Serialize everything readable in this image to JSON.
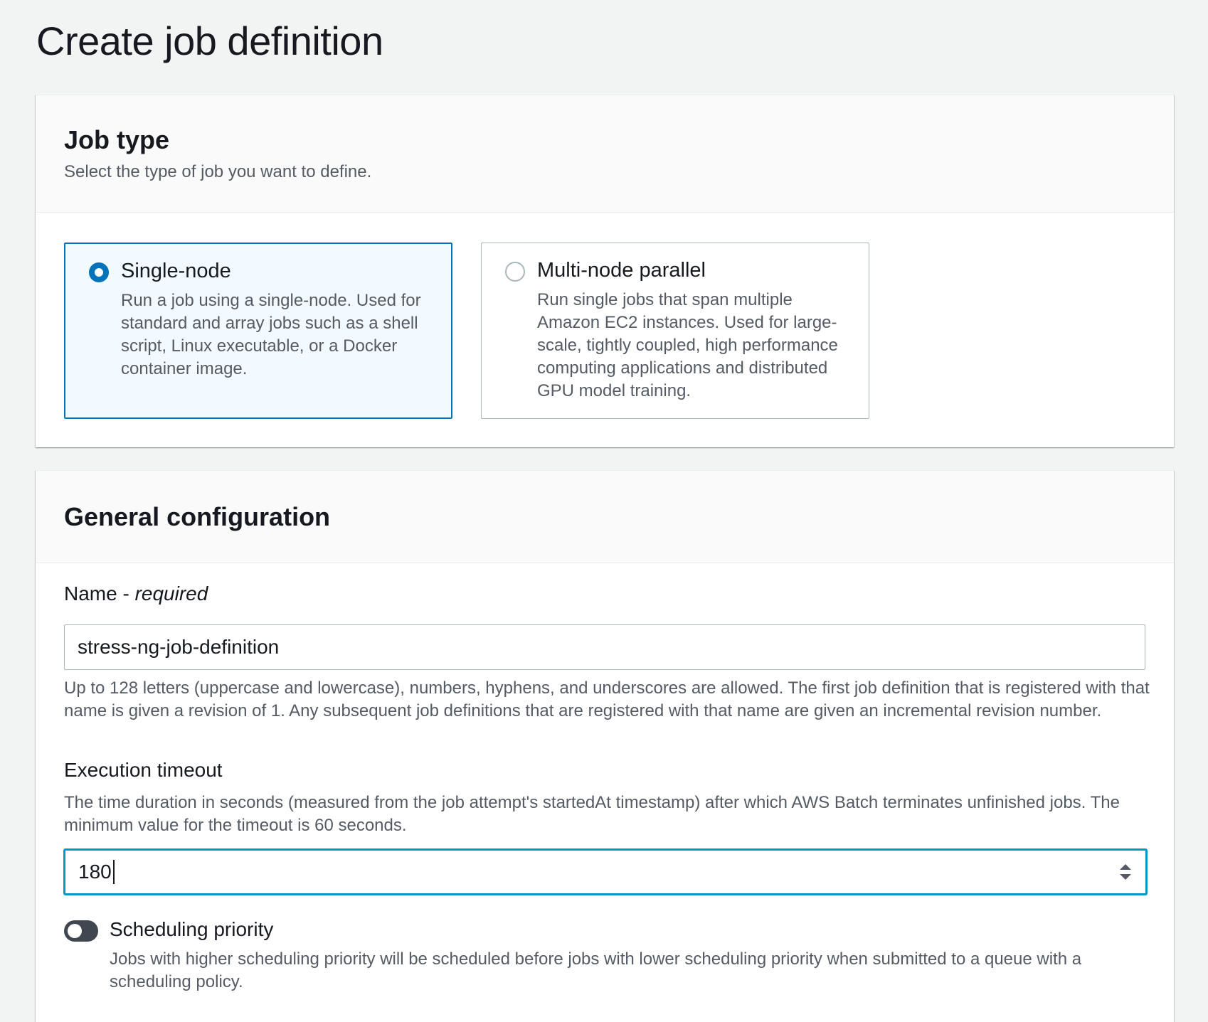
{
  "page": {
    "title": "Create job definition"
  },
  "job_type": {
    "heading": "Job type",
    "description": "Select the type of job you want to define.",
    "options": [
      {
        "title": "Single-node",
        "description": "Run a job using a single-node. Used for standard and array jobs such as a shell script, Linux executable, or a Docker container image.",
        "selected": true
      },
      {
        "title": "Multi-node parallel",
        "description": "Run single jobs that span multiple Amazon EC2 instances. Used for large-scale, tightly coupled, high performance computing applications and distributed GPU model training.",
        "selected": false
      }
    ]
  },
  "general_config": {
    "heading": "General configuration",
    "name_field": {
      "label": "Name - ",
      "required_text": "required",
      "value": "stress-ng-job-definition",
      "help": "Up to 128 letters (uppercase and lowercase), numbers, hyphens, and underscores are allowed. The first job definition that is registered with that name is given a revision of 1. Any subsequent job definitions that are registered with that name are given an incremental revision number."
    },
    "timeout_field": {
      "label": "Execution timeout",
      "description": "The time duration in seconds (measured from the job attempt's startedAt timestamp) after which AWS Batch terminates unfinished jobs. The minimum value for the timeout is 60 seconds.",
      "value": "180"
    },
    "scheduling_priority": {
      "label": "Scheduling priority",
      "description": "Jobs with higher scheduling priority will be scheduled before jobs with lower scheduling priority when submitted to a queue with a scheduling policy.",
      "enabled": false
    }
  },
  "colors": {
    "accent": "#0073bb",
    "focus": "#0099c6",
    "selected_tile_bg": "#f1faff",
    "toggle_off": "#414750"
  },
  "icons": {
    "spinner": "up-down-spinner-icon"
  }
}
